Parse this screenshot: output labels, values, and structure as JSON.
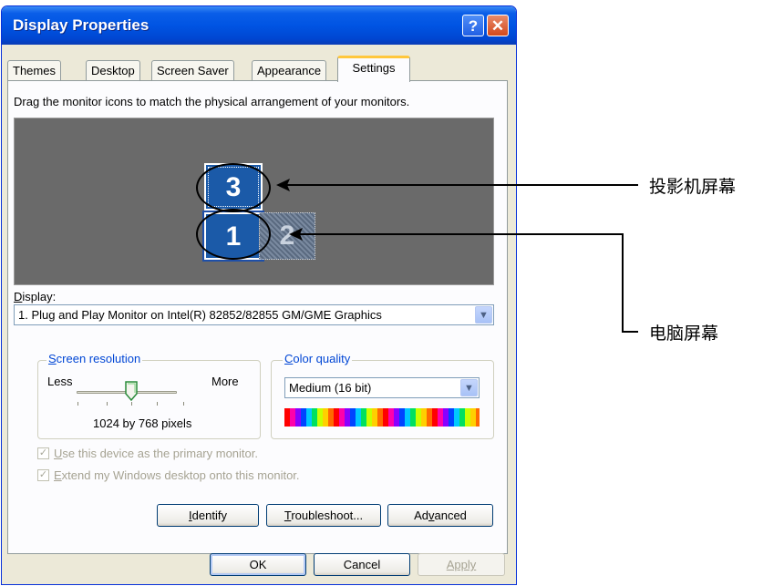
{
  "window": {
    "title": "Display Properties",
    "help_label": "?",
    "close_label": "✕"
  },
  "tabs": [
    "Themes",
    "Desktop",
    "Screen Saver",
    "Appearance",
    "Settings"
  ],
  "active_tab": "Settings",
  "instruction": "Drag the monitor icons to match the physical arrangement of your monitors.",
  "monitors": [
    {
      "number": "3",
      "label": "3"
    },
    {
      "number": "1",
      "label": "1"
    },
    {
      "number": "2",
      "label": "2"
    }
  ],
  "display": {
    "label_accel": "D",
    "label_rest": "isplay:",
    "value": "1. Plug and Play Monitor on Intel(R) 82852/82855 GM/GME Graphics"
  },
  "resolution": {
    "title_accel": "S",
    "title_rest": "creen resolution",
    "less": "Less",
    "more": "More",
    "value_text": "1024 by 768 pixels",
    "slider_position": 0.5
  },
  "color_quality": {
    "title_accel": "C",
    "title_rest": "olor quality",
    "value": "Medium (16 bit)"
  },
  "checkboxes": [
    {
      "accel": "U",
      "rest": "se this device as the primary monitor.",
      "checked": true
    },
    {
      "accel": "E",
      "rest": "xtend my Windows desktop onto this monitor.",
      "checked": true
    }
  ],
  "buttons": {
    "identify": {
      "pre": "",
      "accel": "I",
      "post": "dentify"
    },
    "troubleshoot": {
      "pre": "",
      "accel": "T",
      "post": "roubleshoot..."
    },
    "advanced": {
      "pre": "Ad",
      "accel": "v",
      "post": "anced"
    },
    "ok": "OK",
    "cancel": "Cancel",
    "apply": "Apply"
  },
  "annotations": {
    "projector": "投影机屏幕",
    "computer": "电脑屏幕"
  },
  "colors": {
    "title_blue": "#0054e3",
    "window_bg": "#ece9d8",
    "monitor_blue": "#1b5aa8",
    "tab_highlight": "#ffc73c"
  }
}
